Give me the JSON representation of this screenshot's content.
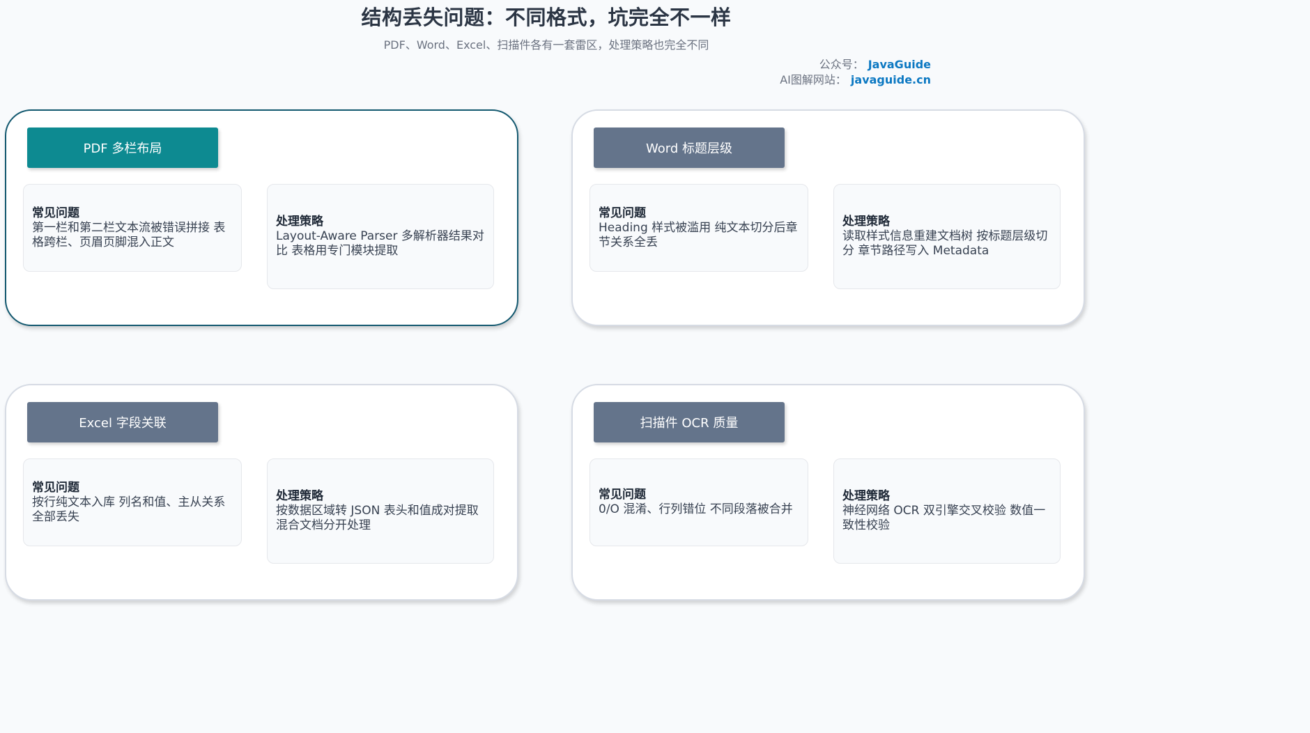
{
  "header": {
    "title": "结构丢失问题：不同格式，坑完全不一样",
    "subtitle": "PDF、Word、Excel、扫描件各有一套雷区，处理策略也完全不同",
    "credit_account_label": "公众号：",
    "credit_account_value": "JavaGuide",
    "credit_site_label": "AI图解网站：",
    "credit_site_value": "javaguide.cn"
  },
  "panels": [
    {
      "label": "PDF 多栏布局",
      "highlighted": true,
      "problem_title": "常见问题",
      "problem_text": "第一栏和第二栏文本流被错误拼接 表格跨栏、页眉页脚混入正文",
      "strategy_title": "处理策略",
      "strategy_text": "Layout-Aware Parser 多解析器结果对比 表格用专门模块提取"
    },
    {
      "label": "Word 标题层级",
      "highlighted": false,
      "problem_title": "常见问题",
      "problem_text": "Heading 样式被滥用 纯文本切分后章节关系全丢",
      "strategy_title": "处理策略",
      "strategy_text": "读取样式信息重建文档树 按标题层级切分 章节路径写入 Metadata"
    },
    {
      "label": "Excel 字段关联",
      "highlighted": false,
      "problem_title": "常见问题",
      "problem_text": "按行纯文本入库 列名和值、主从关系全部丢失",
      "strategy_title": "处理策略",
      "strategy_text": "按数据区域转 JSON 表头和值成对提取 混合文档分开处理"
    },
    {
      "label": "扫描件 OCR 质量",
      "highlighted": false,
      "problem_title": "常见问题",
      "problem_text": "0/O 混淆、行列错位 不同段落被合并",
      "strategy_title": "处理策略",
      "strategy_text": "神经网络 OCR 双引擎交叉校验 数值一致性校验"
    }
  ],
  "colors": {
    "highlight_label": "#0d8a91",
    "default_label": "#64748b",
    "highlight_border": "#12586f",
    "link": "#0b78c2"
  }
}
